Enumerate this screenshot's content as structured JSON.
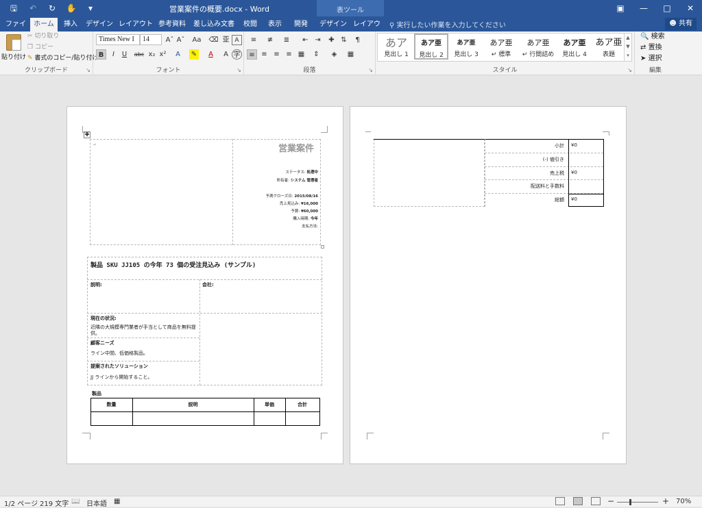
{
  "titlebar": {
    "doc_title": "営業案件の概要.docx - Word",
    "context_group": "表ツール",
    "tell_me": "実行したい作業を入力してください",
    "share": "共有",
    "qat": [
      "save-icon",
      "undo-icon",
      "redo-icon",
      "touch-mode-icon",
      "customize-icon"
    ]
  },
  "tabs": [
    "ファイル",
    "ホーム",
    "挿入",
    "デザイン",
    "レイアウト",
    "参考資料",
    "差し込み文書",
    "校閲",
    "表示",
    "開発",
    "デザイン",
    "レイアウト"
  ],
  "active_tab": "ホーム",
  "ribbon": {
    "clipboard": {
      "label": "クリップボード",
      "paste": "貼り付け",
      "cut": "切り取り",
      "copy": "コピー",
      "format_painter": "書式のコピー/貼り付け"
    },
    "font": {
      "label": "フォント",
      "font_name": "Times New I",
      "font_size": "14"
    },
    "paragraph": {
      "label": "段落"
    },
    "styles": {
      "label": "スタイル",
      "items": [
        {
          "sample": "あア",
          "name": "見出し 1"
        },
        {
          "sample": "あア亜",
          "name": "見出し 2"
        },
        {
          "sample": "あア亜",
          "name": "見出し 3"
        },
        {
          "sample": "あア亜",
          "name": "↵ 標準"
        },
        {
          "sample": "あア亜",
          "name": "↵ 行間詰め"
        },
        {
          "sample": "あア亜",
          "name": "見出し 4"
        },
        {
          "sample": "あア亜",
          "name": "表題"
        }
      ]
    },
    "editing": {
      "label": "編集",
      "find": "検索",
      "replace": "置換",
      "select": "選択"
    }
  },
  "document": {
    "page1": {
      "heading": "営業案件",
      "status_label": "ステータス:",
      "status_value": "処理中",
      "owner_label": "所有者:",
      "owner_value": "システム 管理者",
      "close_date_label": "予測クローズ日:",
      "close_date_value": "2015/08/16",
      "revenue_label": "売上見込み:",
      "revenue_value": "¥16,000",
      "budget_label": "予算:",
      "budget_value": "¥60,000",
      "timeframe_label": "購入時期:",
      "timeframe_value": "今年",
      "payment_label": "支払方法:",
      "opp_title": "製品 SKU JJ105 の今年 73 個の受注見込み (サンプル)",
      "description_label": "説明:",
      "company_label": "会社:",
      "current_status_label": "現在の状況:",
      "current_status_text": "近隣の大規模専門業者が手当として商品を無料提供。",
      "customer_need_label": "顧客ニーズ",
      "customer_need_text": "ライン中間、低価格製品。",
      "solution_label": "提案されたソリューション",
      "solution_text": "JJ ラインから開始すること。",
      "products_label": "製品",
      "product_columns": [
        "数量",
        "説明",
        "単価",
        "合計"
      ]
    },
    "page2": {
      "subtotal_label": "小計",
      "subtotal_value": "¥0",
      "discount_label": "(-) 値引き",
      "tax_label": "売上税",
      "tax_value": "¥0",
      "shipping_label": "配送料と手数料",
      "total_label": "総額",
      "total_value": "¥0"
    }
  },
  "statusbar": {
    "pages": "1/2 ページ",
    "words": "219 文字",
    "language": "日本語",
    "zoom": "70%"
  }
}
